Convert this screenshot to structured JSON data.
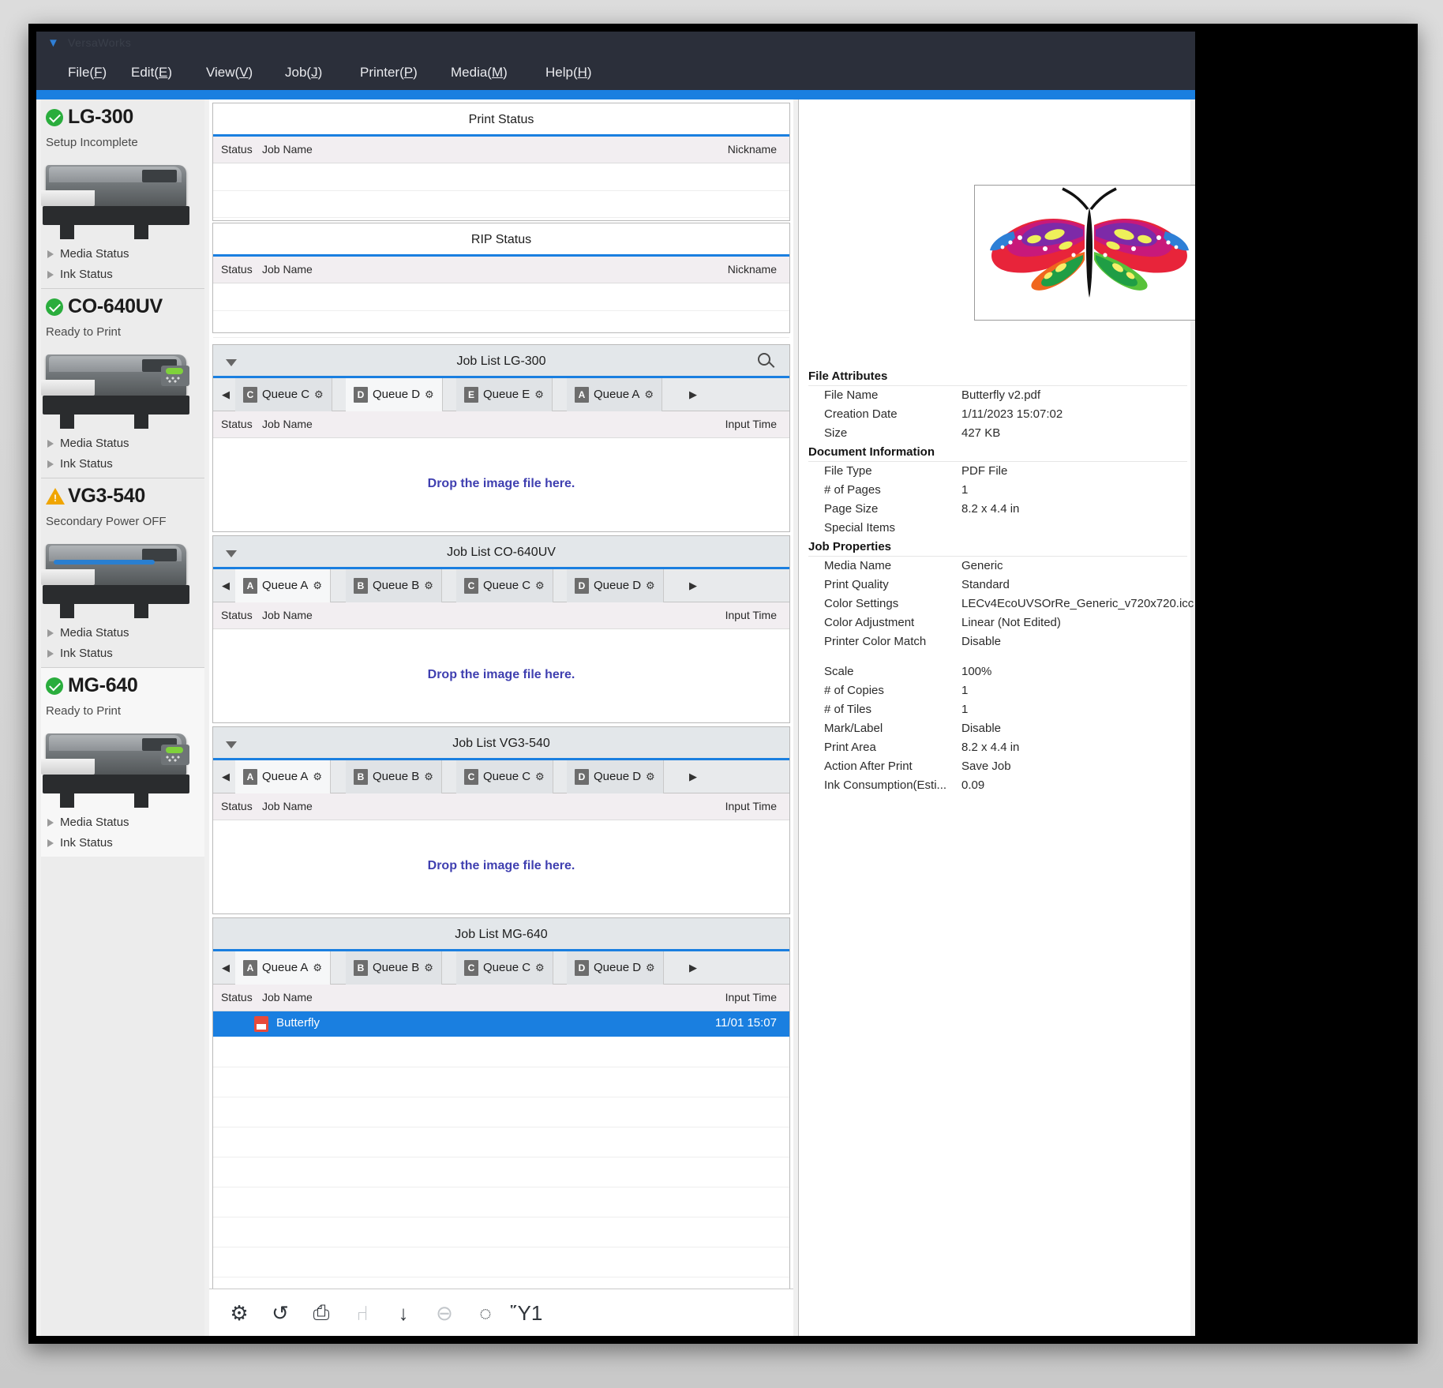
{
  "app": {
    "title": "VersaWorks",
    "menu": [
      {
        "label": "File(F)",
        "accel": "F"
      },
      {
        "label": "Edit(E)",
        "accel": "E"
      },
      {
        "label": "View(V)",
        "accel": "V"
      },
      {
        "label": "Job(J)",
        "accel": "J"
      },
      {
        "label": "Printer(P)",
        "accel": "P"
      },
      {
        "label": "Media(M)",
        "accel": "M"
      },
      {
        "label": "Help(H)",
        "accel": "H"
      }
    ],
    "accent_color": "#1a7fe0"
  },
  "sidebar": {
    "printers": [
      {
        "name": "LG-300",
        "status": "Setup Incomplete",
        "badge": "ok",
        "badge_color": "#2aad3d",
        "media_status_label": "Media Status",
        "ink_status_label": "Ink Status"
      },
      {
        "name": "CO-640UV",
        "status": "Ready to Print",
        "badge": "ok",
        "badge_color": "#2aad3d",
        "media_status_label": "Media Status",
        "ink_status_label": "Ink Status"
      },
      {
        "name": "VG3-540",
        "status": "Secondary Power OFF",
        "badge": "warn",
        "badge_color": "#f0a500",
        "media_status_label": "Media Status",
        "ink_status_label": "Ink Status"
      },
      {
        "name": "MG-640",
        "status": "Ready to Print",
        "badge": "ok",
        "badge_color": "#2aad3d",
        "media_status_label": "Media Status",
        "ink_status_label": "Ink Status"
      }
    ]
  },
  "center": {
    "print_status": {
      "title": "Print Status",
      "columns": {
        "status": "Status",
        "job_name": "Job Name",
        "nickname": "Nickname"
      },
      "rows": []
    },
    "rip_status": {
      "title": "RIP Status",
      "columns": {
        "status": "Status",
        "job_name": "Job Name",
        "nickname": "Nickname"
      },
      "rows": []
    },
    "job_lists": [
      {
        "title": "Job List LG-300",
        "has_caret": true,
        "has_search": true,
        "tabs": [
          {
            "letter": "C",
            "label": "Queue C",
            "active": false
          },
          {
            "letter": "D",
            "label": "Queue D",
            "active": true
          },
          {
            "letter": "E",
            "label": "Queue E",
            "active": false
          },
          {
            "letter": "A",
            "label": "Queue A",
            "active": false
          }
        ],
        "columns": {
          "status": "Status",
          "job_name": "Job Name",
          "input_time": "Input Time"
        },
        "drop_message": "Drop the image file here.",
        "rows": []
      },
      {
        "title": "Job List CO-640UV",
        "has_caret": true,
        "has_search": false,
        "tabs": [
          {
            "letter": "A",
            "label": "Queue A",
            "active": true
          },
          {
            "letter": "B",
            "label": "Queue B",
            "active": false
          },
          {
            "letter": "C",
            "label": "Queue C",
            "active": false
          },
          {
            "letter": "D",
            "label": "Queue D",
            "active": false
          }
        ],
        "columns": {
          "status": "Status",
          "job_name": "Job Name",
          "input_time": "Input Time"
        },
        "drop_message": "Drop the image file here.",
        "rows": []
      },
      {
        "title": "Job List VG3-540",
        "has_caret": true,
        "has_search": false,
        "tabs": [
          {
            "letter": "A",
            "label": "Queue A",
            "active": true
          },
          {
            "letter": "B",
            "label": "Queue B",
            "active": false
          },
          {
            "letter": "C",
            "label": "Queue C",
            "active": false
          },
          {
            "letter": "D",
            "label": "Queue D",
            "active": false
          }
        ],
        "columns": {
          "status": "Status",
          "job_name": "Job Name",
          "input_time": "Input Time"
        },
        "drop_message": "Drop the image file here.",
        "rows": []
      },
      {
        "title": "Job List MG-640",
        "has_caret": false,
        "has_search": false,
        "tabs": [
          {
            "letter": "A",
            "label": "Queue A",
            "active": true
          },
          {
            "letter": "B",
            "label": "Queue B",
            "active": false
          },
          {
            "letter": "C",
            "label": "Queue C",
            "active": false
          },
          {
            "letter": "D",
            "label": "Queue D",
            "active": false
          }
        ],
        "columns": {
          "status": "Status",
          "job_name": "Job Name",
          "input_time": "Input Time"
        },
        "drop_message": "",
        "rows": [
          {
            "name": "Butterfly",
            "input_time": "11/01 15:07",
            "selected": true,
            "icon": "pdf-file-icon"
          }
        ]
      }
    ],
    "toolbar": [
      {
        "icon": "gear-icon",
        "glyph": "⚙",
        "enabled": true
      },
      {
        "icon": "rip-and-print-icon",
        "glyph": "↺",
        "enabled": true
      },
      {
        "icon": "printer-icon",
        "glyph": "⎙",
        "enabled": true
      },
      {
        "icon": "nesting-icon",
        "glyph": "⑁",
        "enabled": false
      },
      {
        "icon": "download-icon",
        "glyph": "↓",
        "enabled": true
      },
      {
        "icon": "abort-icon",
        "glyph": "⊖",
        "enabled": false
      },
      {
        "icon": "busy-spinner-icon",
        "glyph": "◌",
        "enabled": true
      },
      {
        "icon": "trash-icon",
        "glyph": "Ὕ1",
        "enabled": true
      }
    ]
  },
  "properties": {
    "preview_alt": "butterfly-artwork-preview",
    "groups": [
      {
        "title": "File Attributes",
        "rows": [
          {
            "key": "File Name",
            "value": "Butterfly v2.pdf"
          },
          {
            "key": "Creation Date",
            "value": "1/11/2023 15:07:02"
          },
          {
            "key": "Size",
            "value": "427 KB"
          }
        ]
      },
      {
        "title": "Document Information",
        "rows": [
          {
            "key": "File Type",
            "value": "PDF File"
          },
          {
            "key": "# of Pages",
            "value": "1"
          },
          {
            "key": "Page Size",
            "value": "8.2 x 4.4 in"
          },
          {
            "key": "Special Items",
            "value": ""
          }
        ]
      },
      {
        "title": "Job Properties",
        "rows": [
          {
            "key": "Media Name",
            "value": "Generic"
          },
          {
            "key": "Print Quality",
            "value": "Standard"
          },
          {
            "key": "Color Settings",
            "value": "LECv4EcoUVSOrRe_Generic_v720x720.icc"
          },
          {
            "key": "Color Adjustment",
            "value": "Linear (Not Edited)"
          },
          {
            "key": "Printer Color Match",
            "value": "Disable"
          },
          {
            "key": "",
            "value": ""
          },
          {
            "key": "Scale",
            "value": "100%"
          },
          {
            "key": "# of Copies",
            "value": "1"
          },
          {
            "key": "# of Tiles",
            "value": "1"
          },
          {
            "key": "Mark/Label",
            "value": "Disable"
          },
          {
            "key": "Print Area",
            "value": "8.2 x 4.4 in"
          },
          {
            "key": "Action After Print",
            "value": "Save Job"
          },
          {
            "key": "Ink Consumption(Esti...",
            "value": "0.09"
          }
        ]
      }
    ]
  }
}
